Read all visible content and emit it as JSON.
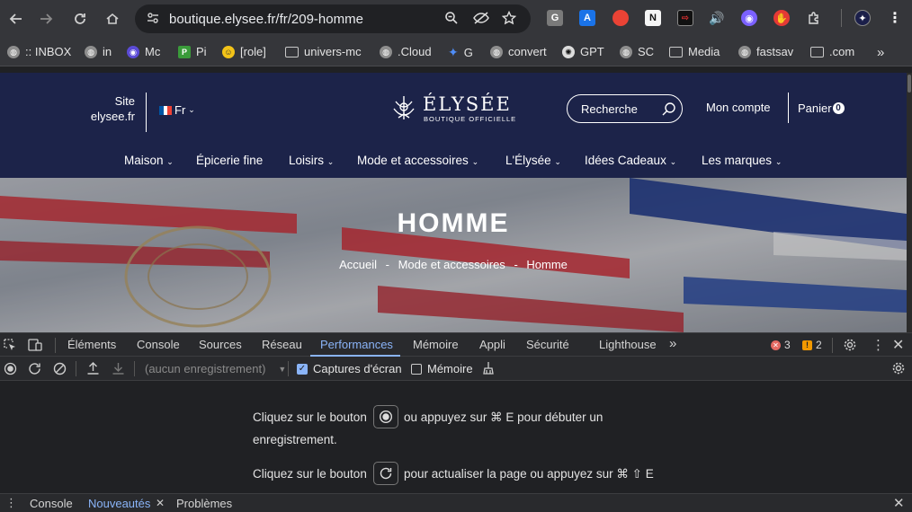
{
  "browser": {
    "url": "boutique.elysee.fr/fr/209-homme",
    "extensions": [
      "G",
      "A",
      "N"
    ]
  },
  "bookmarks": [
    {
      "label": ":: INBOX",
      "icon": "globe-icon"
    },
    {
      "label": "in",
      "icon": "globe-icon"
    },
    {
      "label": "Mc",
      "icon": "mc-icon"
    },
    {
      "label": "Pi",
      "icon": "pi-icon"
    },
    {
      "label": "[role]",
      "icon": "emoji-icon"
    },
    {
      "label": "univers-mc",
      "icon": "folder-icon"
    },
    {
      "label": ".Cloud",
      "icon": "globe-icon"
    },
    {
      "label": "G",
      "icon": "gemini-icon"
    },
    {
      "label": "convert",
      "icon": "globe-icon"
    },
    {
      "label": "GPT",
      "icon": "openai-icon"
    },
    {
      "label": "SC",
      "icon": "globe-icon"
    },
    {
      "label": "Media",
      "icon": "folder-icon"
    },
    {
      "label": "fastsav",
      "icon": "globe-icon"
    },
    {
      "label": ".com",
      "icon": "folder-icon"
    },
    {
      "label": "»",
      "icon": "overflow"
    }
  ],
  "site": {
    "site_link_line1": "Site",
    "site_link_line2": "elysee.fr",
    "lang": "Fr",
    "logo_name": "ÉLYSÉE",
    "logo_sub": "BOUTIQUE OFFICIELLE",
    "search_placeholder": "Recherche",
    "account": "Mon compte",
    "cart": "Panier",
    "cart_count": "0",
    "menu": [
      {
        "label": "Maison",
        "dropdown": true
      },
      {
        "label": "Épicerie fine",
        "dropdown": false
      },
      {
        "label": "Loisirs",
        "dropdown": true
      },
      {
        "label": "Mode et accessoires",
        "dropdown": true
      },
      {
        "label": "L'Élysée",
        "dropdown": true
      },
      {
        "label": "Idées Cadeaux",
        "dropdown": true
      },
      {
        "label": "Les marques",
        "dropdown": true
      }
    ],
    "hero_title": "HOMME",
    "breadcrumb": [
      "Accueil",
      "Mode et accessoires",
      "Homme"
    ],
    "breadcrumb_sep": "-"
  },
  "devtools": {
    "tabs": [
      "Éléments",
      "Console",
      "Sources",
      "Réseau",
      "Performances",
      "Mémoire",
      "Appli",
      "Sécurité",
      "Lighthouse"
    ],
    "active_tab": "Performances",
    "errors": "3",
    "warnings": "2",
    "recording_select": "(aucun enregistrement)",
    "screenshots_label": "Captures d'écran",
    "screenshots_checked": true,
    "memory_label": "Mémoire",
    "memory_checked": false,
    "msg1_a": "Cliquez sur le bouton",
    "msg1_b": "ou appuyez sur ⌘ E pour débuter un",
    "msg1_c": "enregistrement.",
    "msg2_a": "Cliquez sur le bouton",
    "msg2_b": "pour actualiser la page ou appuyez sur ⌘ ⇧ E",
    "drawer_tabs": [
      "Console",
      "Nouveautés",
      "Problèmes"
    ],
    "drawer_active": "Nouveautés",
    "colors": {
      "accent": "#8ab4f8",
      "error": "#e46962",
      "warning": "#f29900"
    }
  }
}
